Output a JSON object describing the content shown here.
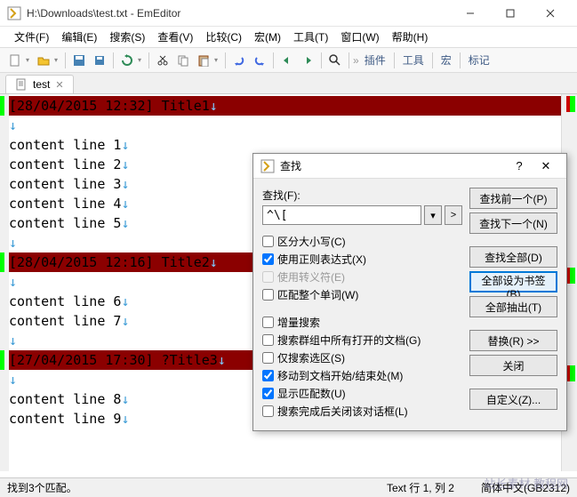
{
  "window": {
    "title": "H:\\Downloads\\test.txt - EmEditor"
  },
  "menu": {
    "file": "文件(F)",
    "edit": "编辑(E)",
    "search": "搜索(S)",
    "view": "查看(V)",
    "compare": "比较(C)",
    "macro": "宏(M)",
    "tools": "工具(T)",
    "window": "窗口(W)",
    "help": "帮助(H)"
  },
  "toolbar_labels": {
    "plugins": "插件",
    "tools": "工具",
    "macro": "宏",
    "markers": "标记"
  },
  "tab": {
    "name": "test"
  },
  "editor": {
    "lines": [
      {
        "type": "hl",
        "text": "[28/04/2015 12:32] Title1"
      },
      {
        "type": "blank",
        "text": ""
      },
      {
        "type": "content",
        "text": "content line 1"
      },
      {
        "type": "content",
        "text": "content line 2"
      },
      {
        "type": "content",
        "text": "content line 3"
      },
      {
        "type": "content",
        "text": "content line 4"
      },
      {
        "type": "content",
        "text": "content line 5"
      },
      {
        "type": "blank",
        "text": ""
      },
      {
        "type": "hl",
        "text": "[28/04/2015 12:16] Title2"
      },
      {
        "type": "blank",
        "text": ""
      },
      {
        "type": "content",
        "text": "content line 6"
      },
      {
        "type": "content",
        "text": "content line 7"
      },
      {
        "type": "blank",
        "text": ""
      },
      {
        "type": "hl",
        "text": "[27/04/2015 17:30] ?Title3"
      },
      {
        "type": "blank",
        "text": ""
      },
      {
        "type": "content",
        "text": "content line 8"
      },
      {
        "type": "content",
        "text": "content line 9"
      }
    ]
  },
  "find": {
    "title": "查找",
    "label": "查找(F):",
    "value": "^\\[",
    "go_btn": ">",
    "checks": {
      "case": "区分大小写(C)",
      "regex": "使用正则表达式(X)",
      "escape": "使用转义符(E)",
      "whole": "匹配整个单词(W)",
      "incremental": "增量搜索",
      "allopen": "搜索群组中所有打开的文档(G)",
      "selection": "仅搜索选区(S)",
      "wrap": "移动到文档开始/结束处(M)",
      "count": "显示匹配数(U)",
      "closeafter": "搜索完成后关闭该对话框(L)"
    },
    "buttons": {
      "prev": "查找前一个(P)",
      "next": "查找下一个(N)",
      "all": "查找全部(D)",
      "bookmark": "全部设为书签(B)",
      "extract": "全部抽出(T)",
      "replace": "替换(R) >>",
      "close": "关闭",
      "custom": "自定义(Z)..."
    }
  },
  "status": {
    "matches": "找到3个匹配。",
    "pos": "Text 行 1, 列 2",
    "encoding": "简体中文(GB2312)"
  },
  "watermark": "站长素材 教程网"
}
